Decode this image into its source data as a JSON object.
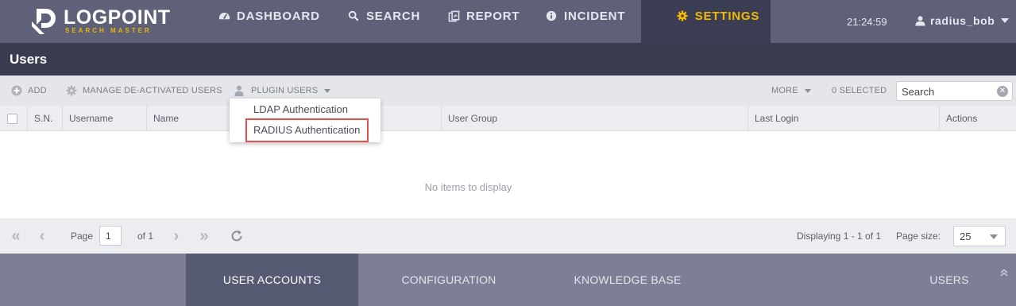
{
  "brand": {
    "name": "LOGPOINT",
    "tagline": "SEARCH MASTER"
  },
  "nav": {
    "items": [
      {
        "label": "DASHBOARD",
        "icon": "dashboard-icon"
      },
      {
        "label": "SEARCH",
        "icon": "search-icon"
      },
      {
        "label": "REPORT",
        "icon": "report-icon"
      },
      {
        "label": "INCIDENT",
        "icon": "info-icon"
      },
      {
        "label": "SETTINGS",
        "icon": "gear-icon",
        "active": true
      }
    ],
    "clock": "21:24:59",
    "username": "radius_bob"
  },
  "page": {
    "title": "Users"
  },
  "toolbar": {
    "add_label": "ADD",
    "manage_label": "MANAGE DE-ACTIVATED USERS",
    "plugin_label": "PLUGIN USERS",
    "more_label": "MORE",
    "selected_label": "0 SELECTED",
    "search_placeholder": "Search"
  },
  "dropdown": {
    "items": [
      "LDAP Authentication",
      "RADIUS Authentication"
    ],
    "highlighted": "RADIUS Authentication"
  },
  "grid": {
    "columns": [
      "S.N.",
      "Username",
      "Name",
      "User Group",
      "Last Login",
      "Actions"
    ],
    "empty_text": "No items to display"
  },
  "pager": {
    "page_label": "Page",
    "page_value": "1",
    "of_label": "of 1",
    "displaying": "Displaying 1 - 1 of 1",
    "page_size_label": "Page size:",
    "page_size_value": "25"
  },
  "bottom_tabs": {
    "items": [
      "USER ACCOUNTS",
      "CONFIGURATION",
      "KNOWLEDGE BASE",
      "USERS"
    ],
    "active": "USER ACCOUNTS"
  },
  "colors": {
    "topbar": "#5e6178",
    "active_nav": "#3b3e52",
    "accent": "#f5b800",
    "highlight_border": "#e4514a",
    "bottombar": "#7c7f95"
  }
}
